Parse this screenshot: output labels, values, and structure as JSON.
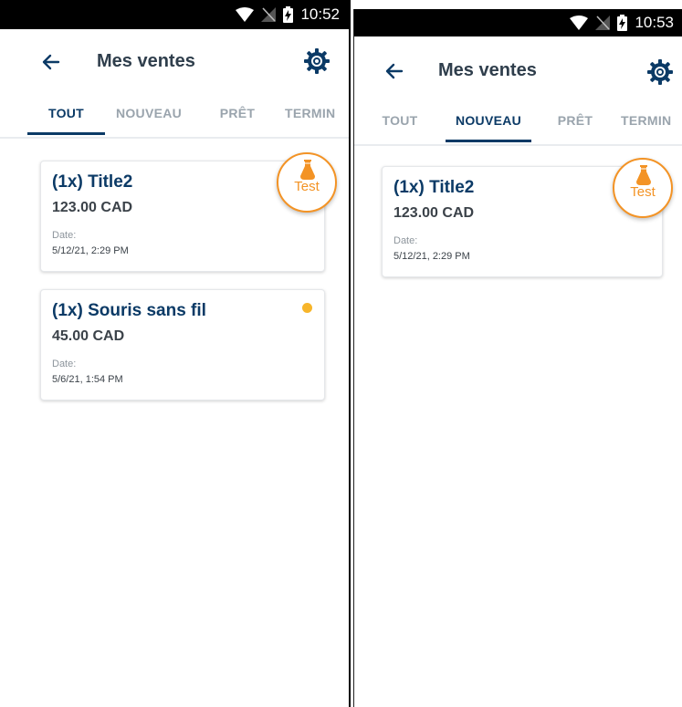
{
  "screens": [
    {
      "status": {
        "time": "10:52"
      },
      "header": {
        "title": "Mes ventes"
      },
      "tabs": [
        {
          "label": "TOUT"
        },
        {
          "label": "NOUVEAU"
        },
        {
          "label": "PRÊT"
        },
        {
          "label": "TERMIN"
        }
      ],
      "active_tab": "TOUT",
      "sales": [
        {
          "title": "(1x) Title2",
          "price": "123.00 CAD",
          "date_label": "Date:",
          "date": "5/12/21, 2:29 PM",
          "badge": "Test"
        },
        {
          "title": "(1x) Souris sans fil",
          "price": "45.00 CAD",
          "date_label": "Date:",
          "date": "5/6/21, 1:54 PM"
        }
      ]
    },
    {
      "status": {
        "time": "10:53"
      },
      "header": {
        "title": "Mes ventes"
      },
      "tabs": [
        {
          "label": "TOUT"
        },
        {
          "label": "NOUVEAU"
        },
        {
          "label": "PRÊT"
        },
        {
          "label": "TERMIN"
        }
      ],
      "active_tab": "NOUVEAU",
      "sales": [
        {
          "title": "(1x) Title2",
          "price": "123.00 CAD",
          "date_label": "Date:",
          "date": "5/12/21, 2:29 PM",
          "badge": "Test"
        }
      ]
    }
  ],
  "colors": {
    "primary": "#0b3a66",
    "accent": "#f39325",
    "status_dot": "#f7b52a",
    "muted": "#9aa4ad"
  },
  "icons": [
    "wifi-icon",
    "signal-off-icon",
    "battery-charging-icon",
    "back-arrow-icon",
    "settings-gear-icon",
    "flask-icon"
  ]
}
